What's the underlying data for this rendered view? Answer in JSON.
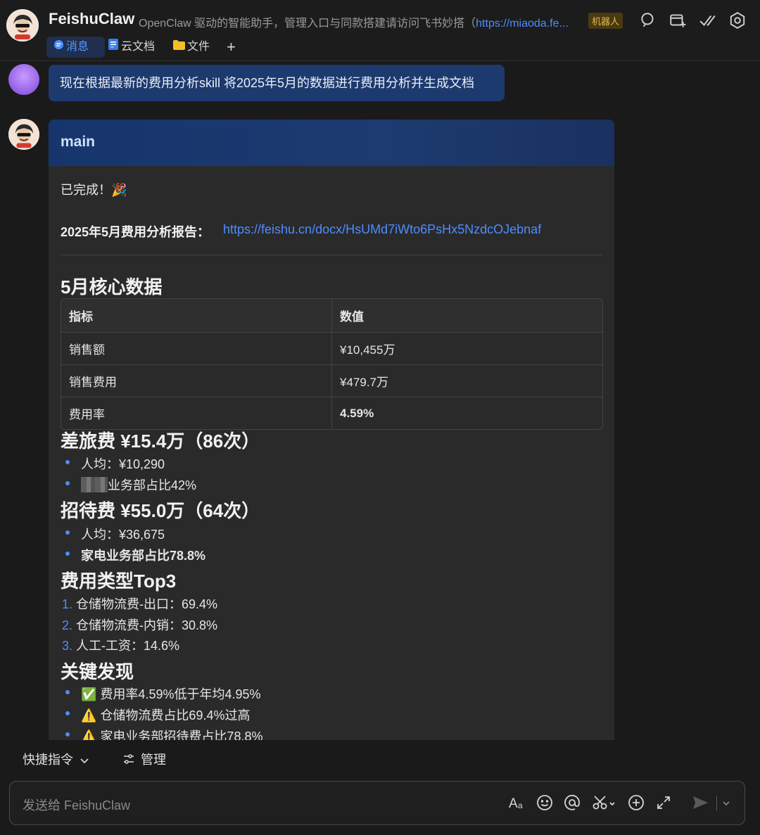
{
  "header": {
    "title": "FeishuClaw",
    "description": "OpenClaw 驱动的智能助手，管理入口与同款搭建请访问飞书妙搭（",
    "description_link": "https://miaoda.fe...",
    "badge": "机器人",
    "icons": [
      "search-icon",
      "add-window-icon",
      "checkmark-icon",
      "settings-icon"
    ]
  },
  "tabs": [
    {
      "label": "消息",
      "icon": "chat-bubble-icon"
    },
    {
      "label": "云文档",
      "icon": "document-icon"
    },
    {
      "label": "文件",
      "icon": "folder-icon"
    },
    {
      "label": "+",
      "icon": "plus-icon"
    }
  ],
  "user_message": "现在根据最新的费用分析skill 将2025年5月的数据进行费用分析并生成文档",
  "bot_card": {
    "header": "main",
    "done_text": "已完成！🎉",
    "report_label": "2025年5月费用分析报告：",
    "report_link": "https://feishu.cn/docx/HsUMd7iWto6PsHx5NzdcOJebnaf",
    "core_title": "5月核心数据",
    "table": {
      "headers": [
        "指标",
        "数值"
      ],
      "rows": [
        [
          "销售额",
          "¥10,455万"
        ],
        [
          "销售费用",
          "¥479.7万"
        ],
        [
          "费用率",
          "4.59%"
        ]
      ]
    },
    "travel_title": "差旅费 ¥15.4万（86次）",
    "travel_items": [
      "人均：¥10,290",
      "业务部占比42%"
    ],
    "hospitality_title": "招待费 ¥55.0万（64次）",
    "hospitality_items": [
      "人均：¥36,675",
      "家电业务部占比78.8%"
    ],
    "top3_title": "费用类型Top3",
    "top3_numbers": [
      "1.",
      "2.",
      "3."
    ],
    "top3_items": [
      "仓储物流费-出口：69.4%",
      "仓储物流费-内销：30.8%",
      "人工-工资：14.6%"
    ],
    "findings_title": "关键发现",
    "findings": [
      {
        "icon": "✅",
        "text": "费用率4.59%低于年均4.95%"
      },
      {
        "icon": "⚠️",
        "text": "仓储物流费占比69.4%过高"
      },
      {
        "icon": "⚠️",
        "text": "家电业务部招待费占比78.8%"
      }
    ]
  },
  "footer": {
    "quick_commands": "快捷指令",
    "manage": "管理",
    "input_placeholder": "发送给 FeishuClaw",
    "toolbar_icons": [
      "text-format-icon",
      "emoji-icon",
      "mention-icon",
      "scissors-icon",
      "add-circle-icon",
      "expand-icon",
      "send-icon",
      "chevron-down-icon"
    ]
  }
}
